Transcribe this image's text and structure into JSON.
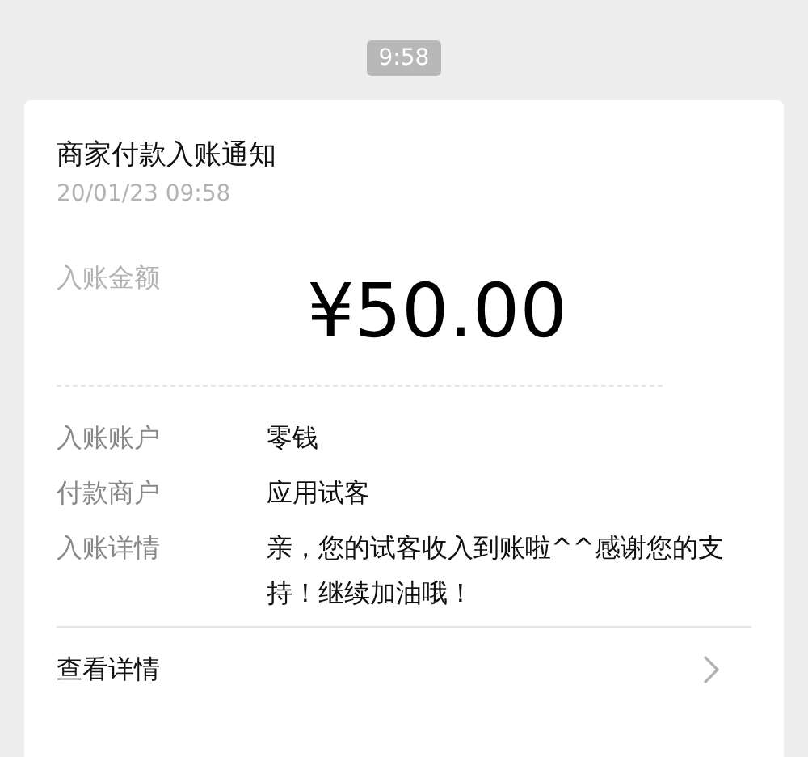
{
  "time": "9:58",
  "card": {
    "title": "商家付款入账通知",
    "date": "20/01/23 09:58",
    "amount_label": "入账金额",
    "amount": "¥50.00",
    "rows": [
      {
        "label": "入账账户",
        "value": "零钱"
      },
      {
        "label": "付款商户",
        "value": "应用试客"
      },
      {
        "label": "入账详情",
        "value": "亲，您的试客收入到账啦^^感谢您的支持！继续加油哦！"
      }
    ],
    "link": "查看详情"
  }
}
